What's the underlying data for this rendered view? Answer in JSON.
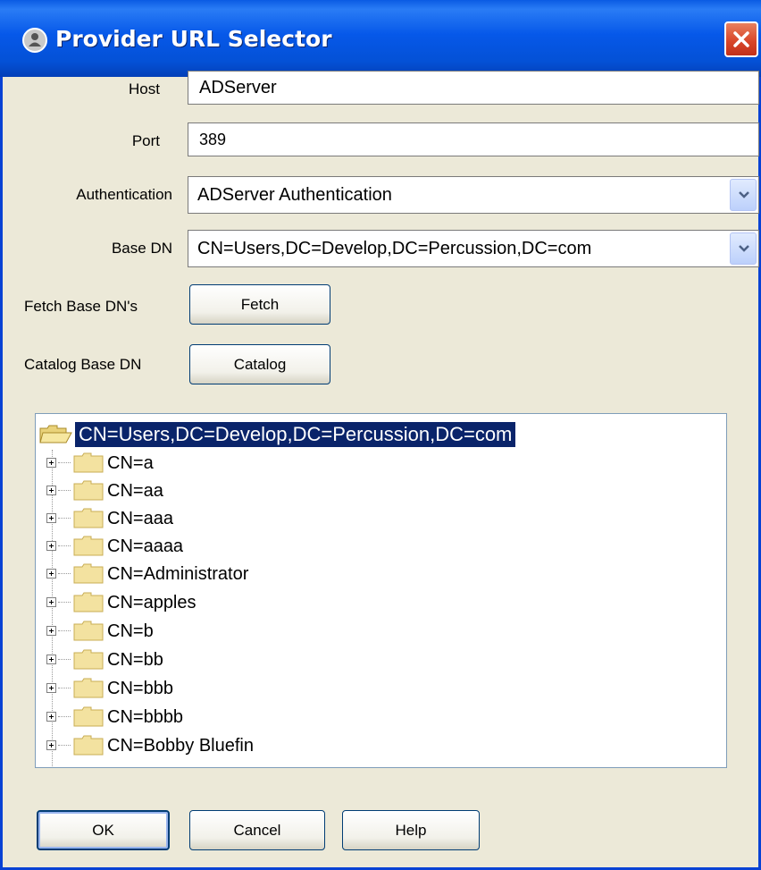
{
  "window": {
    "title": "Provider URL Selector"
  },
  "form": {
    "host_label": "Host",
    "host_value": "ADServer",
    "port_label": "Port",
    "port_value": "389",
    "auth_label": "Authentication",
    "auth_value": "ADServer Authentication",
    "basedn_label": "Base DN",
    "basedn_value": "CN=Users,DC=Develop,DC=Percussion,DC=com",
    "fetch_label": "Fetch Base DN's",
    "fetch_button": "Fetch",
    "catalog_label": "Catalog Base DN",
    "catalog_button": "Catalog"
  },
  "tree": {
    "root": "CN=Users,DC=Develop,DC=Percussion,DC=com",
    "nodes": [
      "CN=a",
      "CN=aa",
      "CN=aaa",
      "CN=aaaa",
      "CN=Administrator",
      "CN=apples",
      "CN=b",
      "CN=bb",
      "CN=bbb",
      "CN=bbbb",
      "CN=Bobby Bluefin"
    ]
  },
  "buttons": {
    "ok": "OK",
    "cancel": "Cancel",
    "help": "Help"
  },
  "colors": {
    "titlebar": "#0658e9",
    "selection": "#0a246a",
    "background": "#ece9d8",
    "close": "#d9472a"
  }
}
